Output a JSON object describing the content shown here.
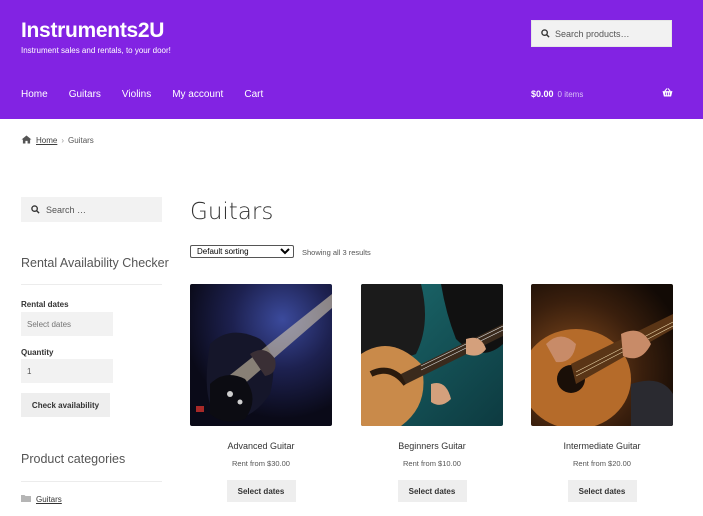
{
  "site": {
    "title": "Instruments2U",
    "tagline": "Instrument sales and rentals, to your door!",
    "accent_color": "#8223e3"
  },
  "header": {
    "search_placeholder": "Search products…",
    "nav": [
      "Home",
      "Guitars",
      "Violins",
      "My account",
      "Cart"
    ],
    "cart_total": "$0.00",
    "cart_count": "0 items"
  },
  "breadcrumb": {
    "home": "Home",
    "current": "Guitars"
  },
  "sidebar": {
    "search_placeholder": "Search …",
    "rental_widget": {
      "title": "Rental Availability Checker",
      "dates_label": "Rental dates",
      "dates_placeholder": "Select dates",
      "quantity_label": "Quantity",
      "quantity_value": "1",
      "button": "Check availability"
    },
    "categories": {
      "title": "Product categories",
      "items": [
        "Guitars"
      ]
    }
  },
  "main": {
    "title": "Guitars",
    "sorting": "Default sorting",
    "result_count": "Showing all 3 results",
    "products": [
      {
        "name": "Advanced Guitar",
        "price": "Rent from $30.00",
        "button": "Select dates"
      },
      {
        "name": "Beginners Guitar",
        "price": "Rent from $10.00",
        "button": "Select dates"
      },
      {
        "name": "Intermediate Guitar",
        "price": "Rent from $20.00",
        "button": "Select dates"
      }
    ]
  }
}
